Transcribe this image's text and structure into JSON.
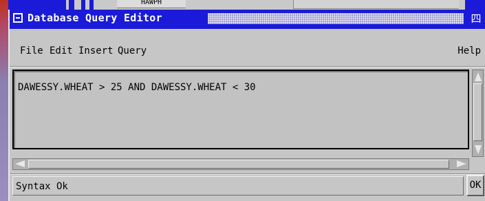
{
  "window": {
    "title": "Database Query Editor",
    "title_bar_color": "#1a1ad8",
    "menu_icon": "window-menu-icon",
    "maximize_icon": "maximize-icon"
  },
  "menu": {
    "items": [
      "File",
      "Edit",
      "Insert",
      "Query"
    ],
    "help": "Help"
  },
  "editor": {
    "query": "DAWESSY.WHEAT > 25 AND DAWESSY.WHEAT < 30"
  },
  "status": {
    "text": "Syntax Ok",
    "ok_label": "OK"
  },
  "background": {
    "field_text": "HAWPH"
  }
}
